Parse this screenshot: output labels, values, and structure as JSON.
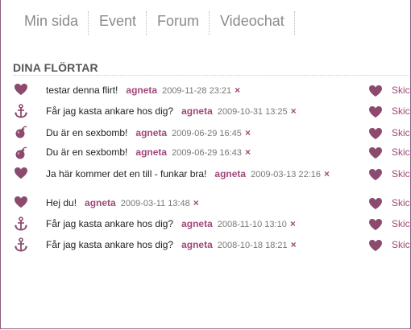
{
  "colors": {
    "accent": "#a0487a",
    "icon": "#8c4a6e",
    "nav_text": "#8a8a8a"
  },
  "nav": {
    "items": [
      {
        "label": "Min sida"
      },
      {
        "label": "Event"
      },
      {
        "label": "Forum"
      },
      {
        "label": "Videochat"
      }
    ]
  },
  "section": {
    "title": "DINA FLÖRTAR"
  },
  "flirts": [
    {
      "icon": "heart-icon",
      "message": "testar denna flirt!",
      "user": "agneta",
      "date": "2009-11-28 23:21",
      "delete": "×",
      "action_label": "Skic"
    },
    {
      "icon": "anchor-icon",
      "message": "Får jag kasta ankare hos dig?",
      "user": "agneta",
      "date": "2009-10-31 13:25",
      "delete": "×",
      "action_label": "Skic"
    },
    {
      "icon": "bomb-icon",
      "message": "Du är en sexbomb!",
      "user": "agneta",
      "date": "2009-06-29 16:45",
      "delete": "×",
      "action_label": "Skic"
    },
    {
      "icon": "bomb-icon",
      "message": "Du är en sexbomb!",
      "user": "agneta",
      "date": "2009-06-29 16:43",
      "delete": "×",
      "action_label": "Skic"
    },
    {
      "icon": "heart-icon",
      "message": "Ja här kommer det en till - funkar bra!",
      "user": "agneta",
      "date": "2009-03-13 22:16",
      "delete": "×",
      "action_label": "Skic"
    },
    {
      "icon": "heart-icon",
      "message": "Hej du!",
      "user": "agneta",
      "date": "2009-03-11 13:48",
      "delete": "×",
      "action_label": "Skic"
    },
    {
      "icon": "anchor-icon",
      "message": "Får jag kasta ankare hos dig?",
      "user": "agneta",
      "date": "2008-11-10 13:10",
      "delete": "×",
      "action_label": "Skic"
    },
    {
      "icon": "anchor-icon",
      "message": "Får jag kasta ankare hos dig?",
      "user": "agneta",
      "date": "2008-10-18 18:21",
      "delete": "×",
      "action_label": "Skic"
    }
  ]
}
